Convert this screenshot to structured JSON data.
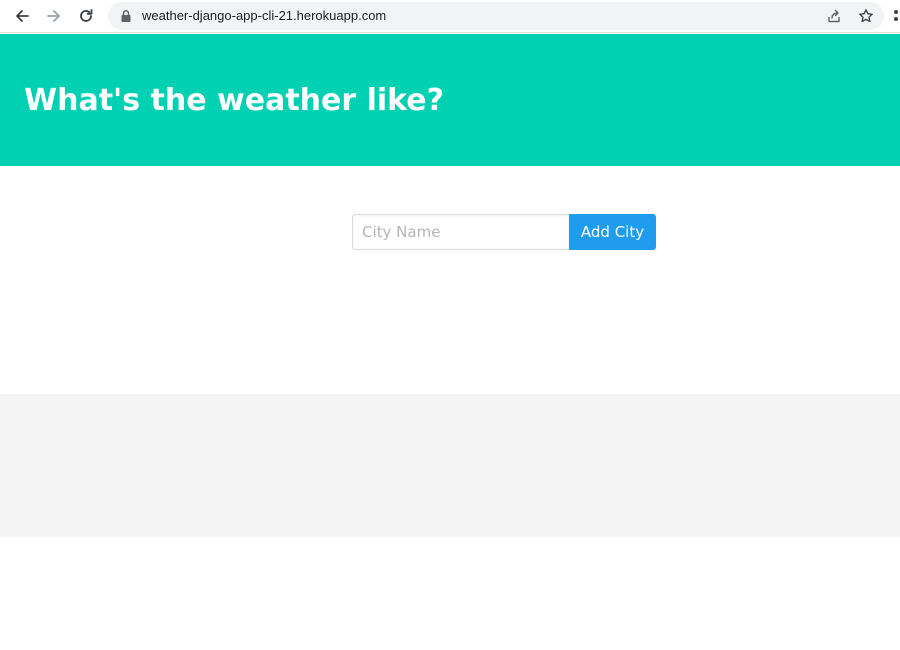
{
  "browser": {
    "url": "weather-django-app-cli-21.herokuapp.com"
  },
  "page": {
    "title": "What's the weather like?",
    "city_input_placeholder": "City Name",
    "city_input_value": "",
    "add_button_label": "Add City"
  },
  "colors": {
    "hero_background": "#00d1b2",
    "button_background": "#209cee",
    "results_background": "#f4f4f4"
  }
}
